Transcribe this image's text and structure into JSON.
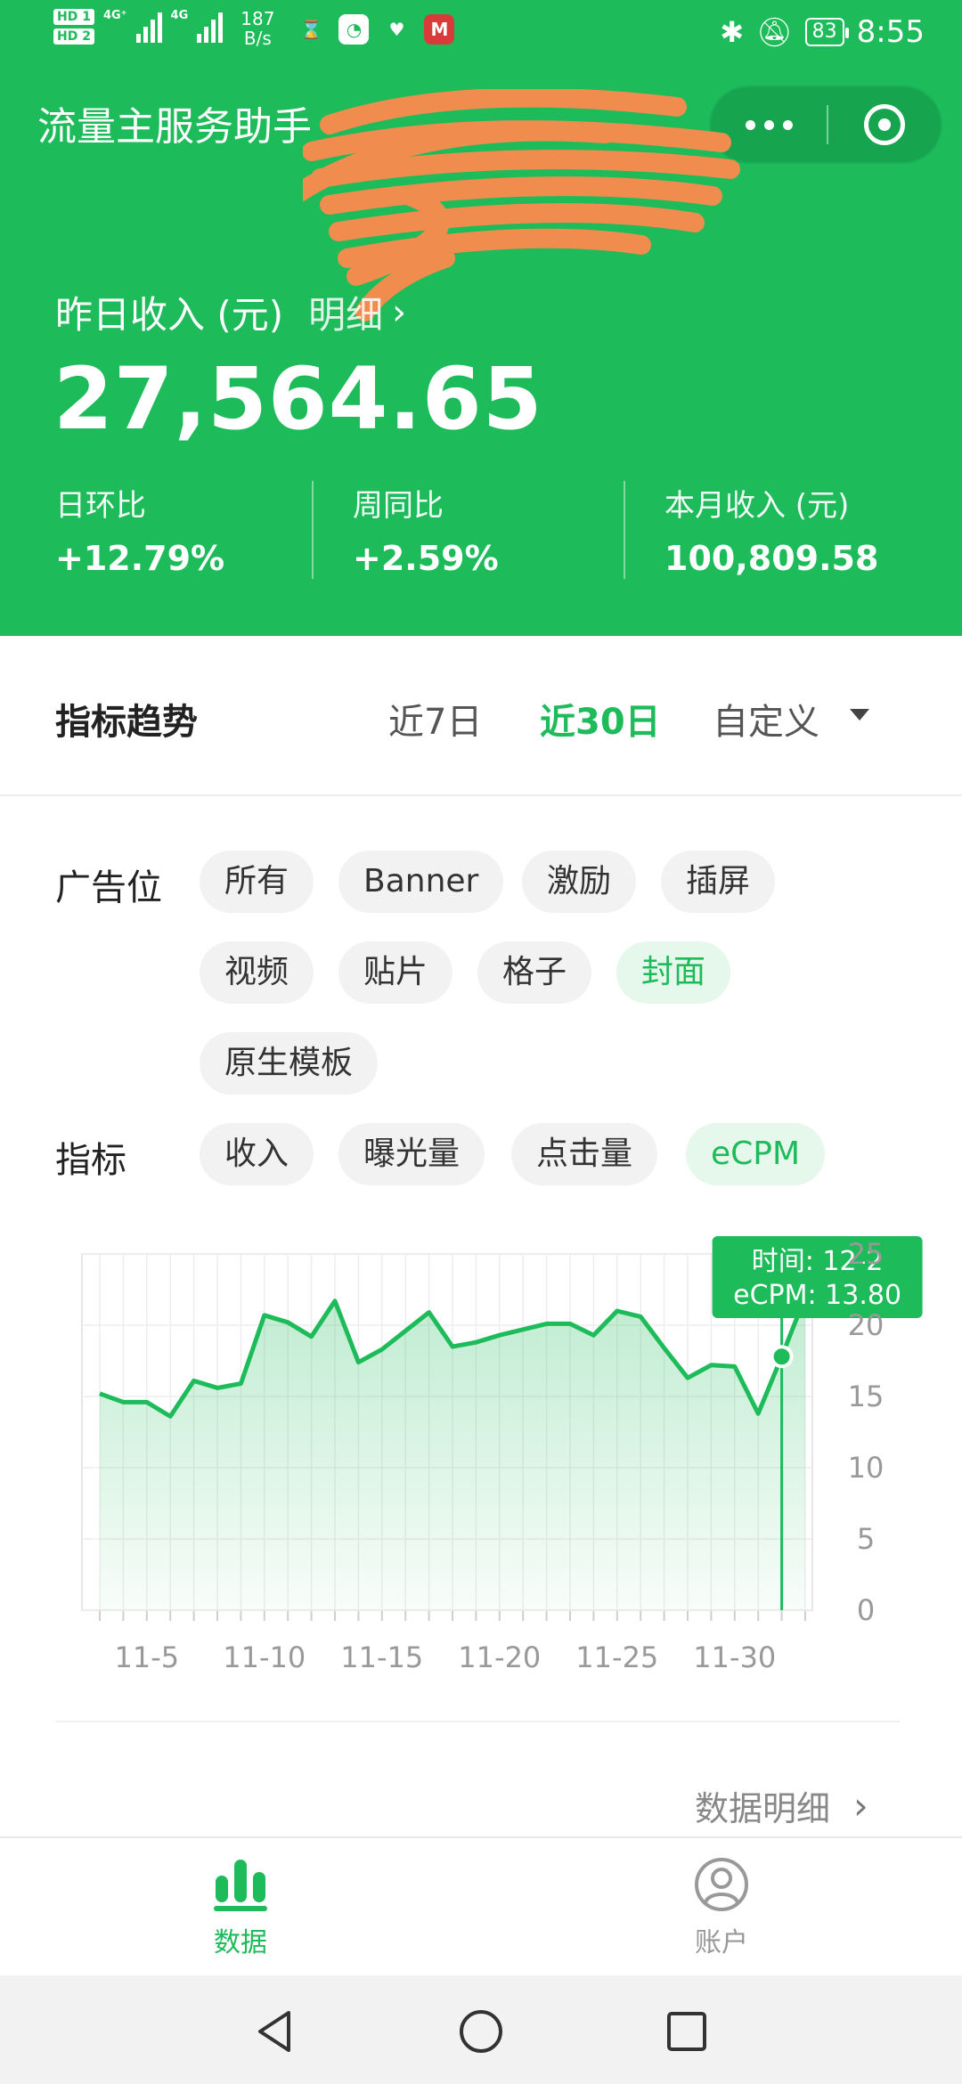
{
  "status_bar": {
    "sim1": "HD 1",
    "sim2": "HD 2",
    "net_tag1": "4G⁺",
    "net_tag2": "4G",
    "speed_value": "187",
    "speed_unit": "B/s",
    "battery": "83",
    "time": "8:55"
  },
  "header": {
    "app_title": "流量主服务助手",
    "yesterday_label": "昨日收入 (元)",
    "detail_link": "明细",
    "yesterday_value": "27,564.65",
    "stats": [
      {
        "label": "日环比",
        "value": "+12.79%"
      },
      {
        "label": "周同比",
        "value": "+2.59%"
      },
      {
        "label": "本月收入 (元)",
        "value": "100,809.58"
      }
    ]
  },
  "trend": {
    "title": "指标趋势",
    "ranges": [
      "近7日",
      "近30日",
      "自定义"
    ],
    "active_range": "近30日"
  },
  "filters": {
    "ad_slot_label": "广告位",
    "ad_slots": [
      "所有",
      "Banner",
      "激励",
      "插屏",
      "视频",
      "贴片",
      "格子",
      "封面",
      "原生模板"
    ],
    "active_ad_slot": "封面",
    "metric_label": "指标",
    "metrics": [
      "收入",
      "曝光量",
      "点击量",
      "eCPM"
    ],
    "active_metric": "eCPM"
  },
  "chart_data": {
    "type": "area",
    "x": [
      "11-3",
      "11-4",
      "11-5",
      "11-6",
      "11-7",
      "11-8",
      "11-9",
      "11-10",
      "11-11",
      "11-12",
      "11-13",
      "11-14",
      "11-15",
      "11-16",
      "11-17",
      "11-18",
      "11-19",
      "11-20",
      "11-21",
      "11-22",
      "11-23",
      "11-24",
      "11-25",
      "11-26",
      "11-27",
      "11-28",
      "11-29",
      "11-30",
      "12-1",
      "12-2",
      "12-3"
    ],
    "x_tick_labels": [
      "11-5",
      "11-10",
      "11-15",
      "11-20",
      "11-25",
      "11-30"
    ],
    "y": [
      15.2,
      14.6,
      14.6,
      13.6,
      16.1,
      15.6,
      15.9,
      20.7,
      20.2,
      19.2,
      21.7,
      17.4,
      18.3,
      19.6,
      20.9,
      18.5,
      18.8,
      19.3,
      19.7,
      20.1,
      20.1,
      19.3,
      21.0,
      20.6,
      18.4,
      16.3,
      17.2,
      17.1,
      13.8,
      17.8,
      22.0
    ],
    "y_ticks": [
      0,
      5,
      10,
      15,
      20,
      25
    ],
    "ylim": [
      0,
      25
    ],
    "series_color": "#1dbb5a",
    "tooltip": {
      "line1": "时间: 12-2",
      "line2": "eCPM: 13.80"
    }
  },
  "data_detail_link": "数据明细",
  "tabbar": {
    "tabs": [
      {
        "label": "数据",
        "icon": "bar-chart-icon",
        "active": true
      },
      {
        "label": "账户",
        "icon": "user-icon",
        "active": false
      }
    ]
  }
}
